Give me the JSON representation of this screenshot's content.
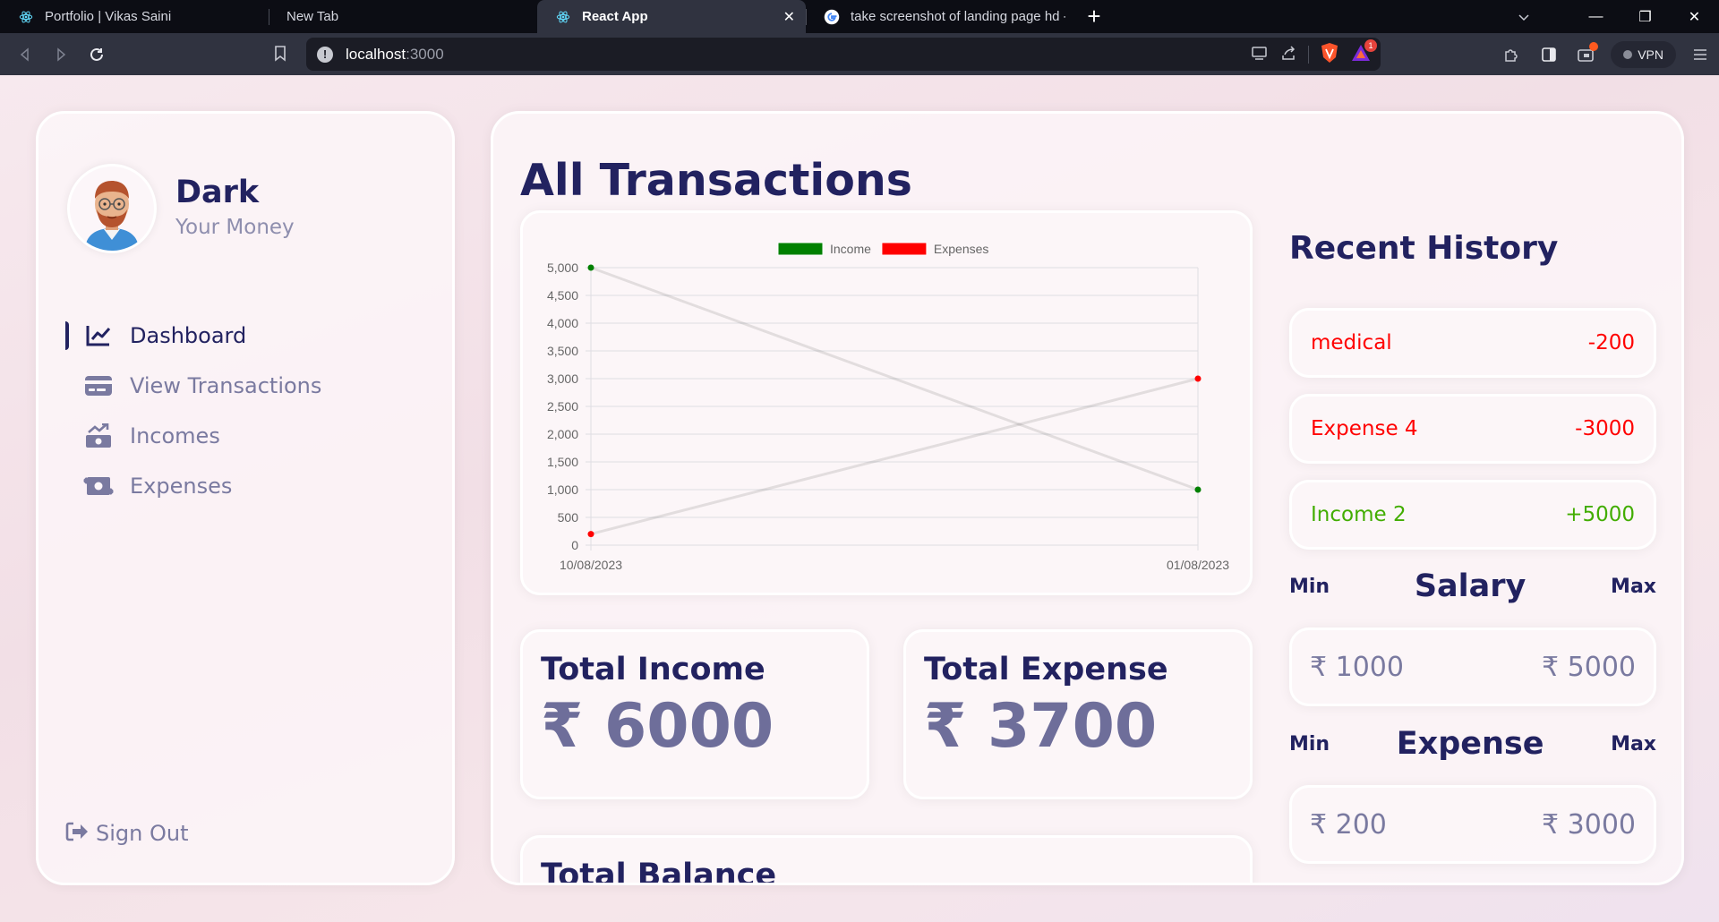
{
  "browser": {
    "tabs": [
      {
        "title": "Portfolio | Vikas Saini",
        "icon": "react-icon",
        "active": false
      },
      {
        "title": "New Tab",
        "icon": "none",
        "active": false
      },
      {
        "title": "React App",
        "icon": "react-icon",
        "active": true
      },
      {
        "title": "take screenshot of landing page hd - (",
        "icon": "google-icon",
        "active": false
      }
    ],
    "url_host": "localhost",
    "url_port": ":3000",
    "vpn_label": "VPN",
    "notification_count": "1"
  },
  "sidebar": {
    "user_name": "Dark",
    "user_subtitle": "Your Money",
    "menu": [
      {
        "label": "Dashboard",
        "icon": "line-chart-icon",
        "active": true
      },
      {
        "label": "View Transactions",
        "icon": "credit-card-icon",
        "active": false
      },
      {
        "label": "Incomes",
        "icon": "money-bill-trend-up-icon",
        "active": false
      },
      {
        "label": "Expenses",
        "icon": "money-bill-transfer-icon",
        "active": false
      }
    ],
    "signout_label": "Sign Out"
  },
  "main": {
    "title": "All Transactions",
    "total_income": {
      "title": "Total Income",
      "value": "₹ 6000"
    },
    "total_expense": {
      "title": "Total Expense",
      "value": "₹ 3700"
    },
    "total_balance": {
      "title": "Total Balance"
    },
    "history_title": "Recent History",
    "history": [
      {
        "label": "medical",
        "amount": "-200",
        "type": "expense"
      },
      {
        "label": "Expense 4",
        "amount": "-3000",
        "type": "expense"
      },
      {
        "label": "Income 2",
        "amount": "+5000",
        "type": "income"
      }
    ],
    "salary": {
      "min_label": "Min",
      "title": "Salary",
      "max_label": "Max",
      "min_value": "₹ 1000",
      "max_value": "₹ 5000"
    },
    "expense": {
      "min_label": "Min",
      "title": "Expense",
      "max_label": "Max",
      "min_value": "₹ 200",
      "max_value": "₹ 3000"
    }
  },
  "colors": {
    "primary": "#222260",
    "muted": "#7a7aa0",
    "income": "#42AD00",
    "expense": "#ff0000",
    "legend_income": "#008000"
  },
  "chart_data": {
    "type": "line",
    "categories": [
      "10/08/2023",
      "01/08/2023"
    ],
    "series": [
      {
        "name": "Income",
        "color": "#008000",
        "values": [
          5000,
          1000
        ]
      },
      {
        "name": "Expenses",
        "color": "#ff0000",
        "values": [
          200,
          3000
        ]
      }
    ],
    "yticks": [
      "5,000",
      "4,500",
      "4,000",
      "3,500",
      "3,000",
      "2,500",
      "2,000",
      "1,500",
      "1,000",
      "500",
      "0"
    ],
    "ylim": [
      0,
      5000
    ],
    "grid": true,
    "legend_position": "top-center"
  }
}
